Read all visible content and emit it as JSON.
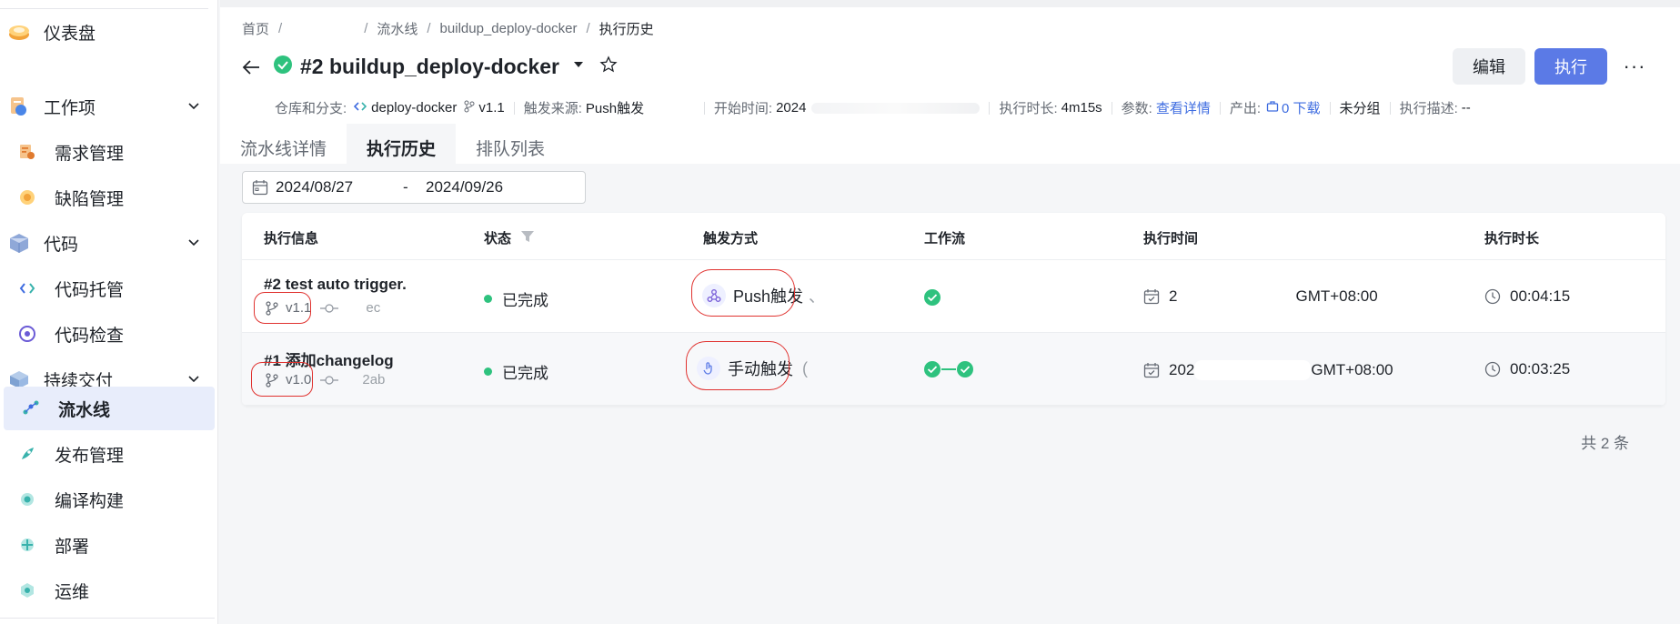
{
  "sidebar": {
    "items": [
      {
        "label": "仪表盘"
      },
      {
        "label": "工作项"
      },
      {
        "label": "需求管理"
      },
      {
        "label": "缺陷管理"
      },
      {
        "label": "代码"
      },
      {
        "label": "代码托管"
      },
      {
        "label": "代码检查"
      },
      {
        "label": "持续交付"
      },
      {
        "label": "流水线"
      },
      {
        "label": "发布管理"
      },
      {
        "label": "编译构建"
      },
      {
        "label": "部署"
      },
      {
        "label": "运维"
      }
    ]
  },
  "breadcrumb": {
    "home": "首页",
    "sep": "/",
    "pipelines": "流水线",
    "pipeline": "buildup_deploy-docker",
    "current": "执行历史"
  },
  "header": {
    "title": "#2 buildup_deploy-docker",
    "edit_label": "编辑",
    "run_label": "执行",
    "more_label": "···"
  },
  "meta": {
    "repo_branch_key": "仓库和分支:",
    "repo": "deploy-docker",
    "branch": "v1.1",
    "trigger_key": "触发来源:",
    "trigger_value": "Push触发",
    "start_key": "开始时间:",
    "start_value": "2024",
    "duration_key": "执行时长:",
    "duration_value": "4m15s",
    "params_key": "参数:",
    "params_link": "查看详情",
    "output_key": "产出:",
    "output_link": "0 下载",
    "group_value": "未分组",
    "desc_key": "执行描述:",
    "desc_value": "--"
  },
  "tabs": [
    {
      "label": "流水线详情"
    },
    {
      "label": "执行历史"
    },
    {
      "label": "排队列表"
    }
  ],
  "filter": {
    "start_date": "2024/08/27",
    "dash": "-",
    "end_date": "2024/09/26"
  },
  "table": {
    "columns": [
      "执行信息",
      "状态",
      "触发方式",
      "工作流",
      "执行时间",
      "执行时长"
    ],
    "rows": [
      {
        "title": "#2 test auto trigger.",
        "version": "v1.1",
        "commit": "ec",
        "status": "已完成",
        "trigger": "Push触发",
        "trigger_extra": "、",
        "time_prefix": "2",
        "time_suffix": "GMT+08:00",
        "duration": "00:04:15"
      },
      {
        "title": "#1 添加changelog",
        "version": "v1.0",
        "commit": "2ab",
        "status": "已完成",
        "trigger": "手动触发",
        "trigger_extra": "(",
        "time_prefix": "202",
        "time_suffix": "GMT+08:00",
        "duration": "00:03:25"
      }
    ]
  },
  "pagination": {
    "total": "共 2 条"
  },
  "colors": {
    "primary": "#5b7ae6",
    "success": "#2ec27e",
    "link": "#3e6ce0",
    "annotation": "#e0322f"
  }
}
